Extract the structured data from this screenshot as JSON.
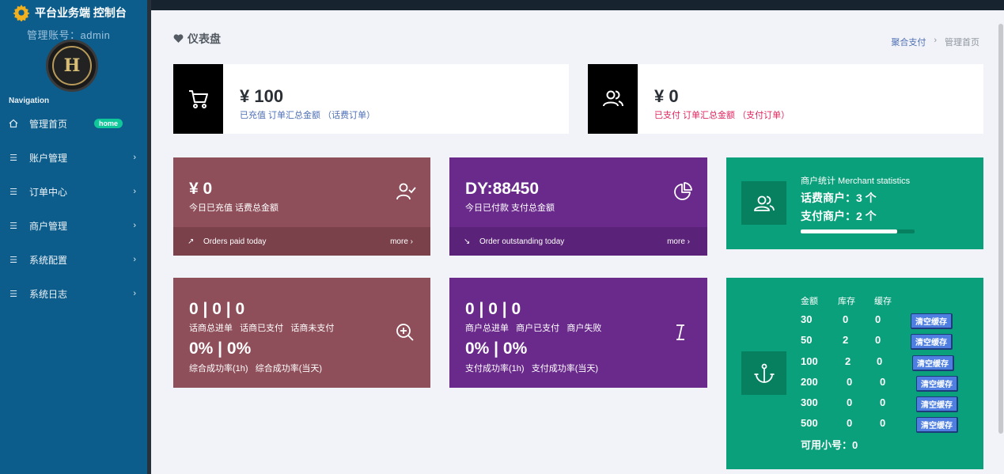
{
  "sidebar": {
    "brand": "平台业务端 控制台",
    "account": "管理账号：admin",
    "avatar_letter": "H",
    "nav_title": "Navigation",
    "items": [
      {
        "label": "管理首页",
        "badge": "home",
        "icon": "home-icon"
      },
      {
        "label": "账户管理",
        "icon": "list-icon"
      },
      {
        "label": "订单中心",
        "icon": "list-icon"
      },
      {
        "label": "商户管理",
        "icon": "list-icon"
      },
      {
        "label": "系统配置",
        "icon": "list-icon"
      },
      {
        "label": "系统日志",
        "icon": "list-icon"
      }
    ]
  },
  "header": {
    "title": "仪表盘",
    "breadcrumb": [
      "聚合支付",
      "管理首页"
    ]
  },
  "cards_top": [
    {
      "value": "¥ 100",
      "sub": "已充值 订单汇总金额 （话费订单）",
      "sub_color": "#4e6fb5"
    },
    {
      "value": "¥ 0",
      "sub": "已支付 订单汇总金额 （支付订单）",
      "sub_color": "#e0245e"
    }
  ],
  "card_today_recharge": {
    "value": "¥ 0",
    "sub": "今日已充值 话费总金额",
    "foot": "Orders paid today",
    "more": "more"
  },
  "card_today_paid": {
    "value": "DY:88450",
    "sub": "今日已付款 支付总金额",
    "foot": "Order outstanding today",
    "more": "more"
  },
  "merchant_stats": {
    "title": "商户统计 Merchant statistics",
    "line1": "话费商户：3 个",
    "line2": "支付商户：2 个",
    "progress": 0.85
  },
  "card_hs_stats": {
    "row1": "0 | 0 | 0",
    "row1_labels": "话商总进单   话商已支付   话商未支付",
    "row2": "0% | 0%",
    "row2_labels": "综合成功率(1h)   综合成功率(当天)"
  },
  "card_merchant_stats": {
    "row1": "0 | 0 | 0",
    "row1_labels": "商户总进单   商户已支付   商户失败",
    "row2": "0% | 0%",
    "row2_labels": "支付成功率(1h)   支付成功率(当天)"
  },
  "stock_table": {
    "headers": [
      "金额",
      "库存",
      "缓存"
    ],
    "rows": [
      {
        "amount": "30",
        "stock": "0",
        "cache": "0",
        "btn": "清空缓存"
      },
      {
        "amount": "50",
        "stock": "2",
        "cache": "0",
        "btn": "清空缓存"
      },
      {
        "amount": "100",
        "stock": "2",
        "cache": "0",
        "btn": "清空缓存"
      },
      {
        "amount": "200",
        "stock": "0",
        "cache": "0",
        "btn": "清空缓存"
      },
      {
        "amount": "300",
        "stock": "0",
        "cache": "0",
        "btn": "清空缓存"
      },
      {
        "amount": "500",
        "stock": "0",
        "cache": "0",
        "btn": "清空缓存"
      }
    ],
    "footer": "可用小号：0"
  },
  "colors": {
    "sidebar": "#0d5d8c",
    "maroon": "#8e4f5a",
    "maroon_dark": "#7a414b",
    "purple": "#6a2a8c",
    "purple_dark": "#5a2278",
    "green": "#0aa07b"
  }
}
